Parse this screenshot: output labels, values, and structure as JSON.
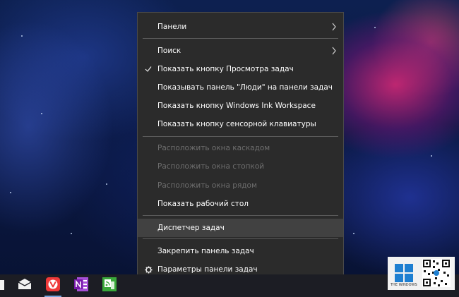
{
  "context_menu": {
    "items": [
      {
        "label": "Панели",
        "submenu": true
      },
      {
        "label": "Поиск",
        "submenu": true
      },
      {
        "label": "Показать кнопку Просмотра задач",
        "checked": true
      },
      {
        "label": "Показывать панель \"Люди\" на панели задач"
      },
      {
        "label": "Показать кнопку Windows Ink Workspace"
      },
      {
        "label": "Показать кнопку сенсорной клавиатуры"
      },
      {
        "label": "Расположить окна каскадом",
        "disabled": true
      },
      {
        "label": "Расположить окна стопкой",
        "disabled": true
      },
      {
        "label": "Расположить окна рядом",
        "disabled": true
      },
      {
        "label": "Показать рабочий стол"
      },
      {
        "label": "Диспетчер задач",
        "highlighted": true
      },
      {
        "label": "Закрепить панель задач"
      },
      {
        "label": "Параметры панели задач",
        "icon": "gear-icon"
      }
    ]
  },
  "taskbar": {
    "icons": [
      "app-icon-partial",
      "mail-icon",
      "vivaldi-icon",
      "onenote-icon",
      "feed-reader-icon"
    ]
  },
  "watermark": {
    "logo_text": "THE WINDOWS"
  },
  "colors": {
    "menu_bg": "#2b2b2b",
    "highlight": "#414141",
    "vivaldi_red": "#ef3939",
    "onenote_purple": "#7719aa",
    "feed_green": "#3aa83a"
  }
}
